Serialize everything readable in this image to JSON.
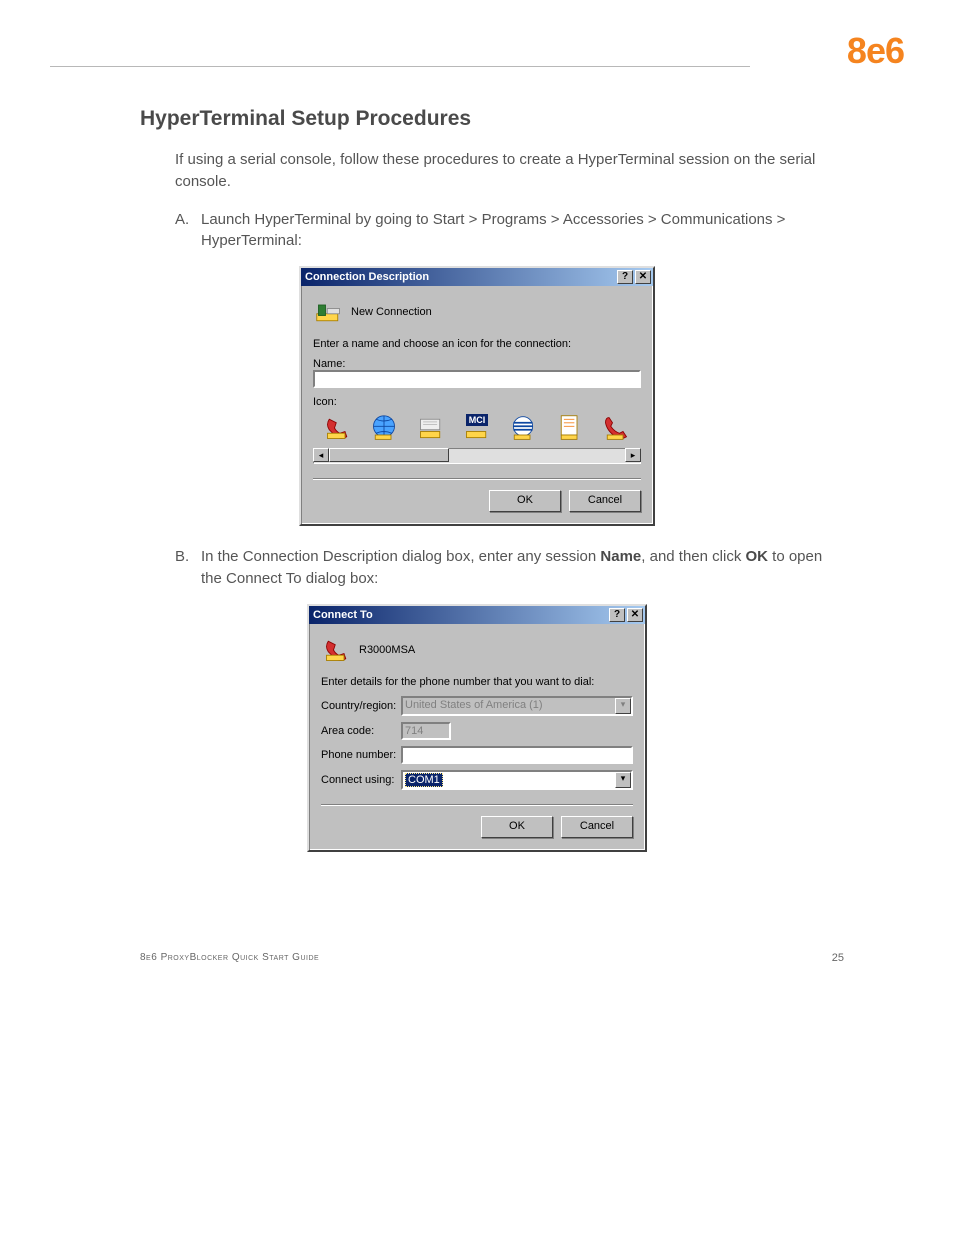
{
  "logo": "8e6",
  "heading": "HyperTerminal Setup Procedures",
  "intro": "If using a serial console, follow these procedures to create a HyperTerminal session on the serial console.",
  "stepA": {
    "letter": "A.",
    "text": "Launch HyperTerminal by going to Start > Programs > Accessories > Communications > HyperTerminal:"
  },
  "stepB": {
    "letter": "B.",
    "text_prefix": "In the Connection Description dialog box, enter any session ",
    "bold1": "Name",
    "text_mid": ", and then click ",
    "bold2": "OK",
    "text_suffix": " to open the Connect To dialog box:"
  },
  "dialog1": {
    "title": "Connection Description",
    "conn_label": "New Connection",
    "instr": "Enter a name and choose an icon for the connection:",
    "name_label": "Name:",
    "name_value": "",
    "icon_label": "Icon:",
    "ok": "OK",
    "cancel": "Cancel"
  },
  "dialog2": {
    "title": "Connect To",
    "conn_name": "R3000MSA",
    "instr": "Enter details for the phone number that you want to dial:",
    "country_label": "Country/region:",
    "country_value": "United States of America (1)",
    "area_label": "Area code:",
    "area_value": "714",
    "phone_label": "Phone number:",
    "phone_value": "",
    "using_label": "Connect using:",
    "using_value": "COM1",
    "ok": "OK",
    "cancel": "Cancel"
  },
  "footer": {
    "left": "8e6 ProxyBlocker Quick Start Guide",
    "page": "25"
  },
  "icons": {
    "help": "?",
    "close": "✕",
    "mci": "MCI"
  }
}
